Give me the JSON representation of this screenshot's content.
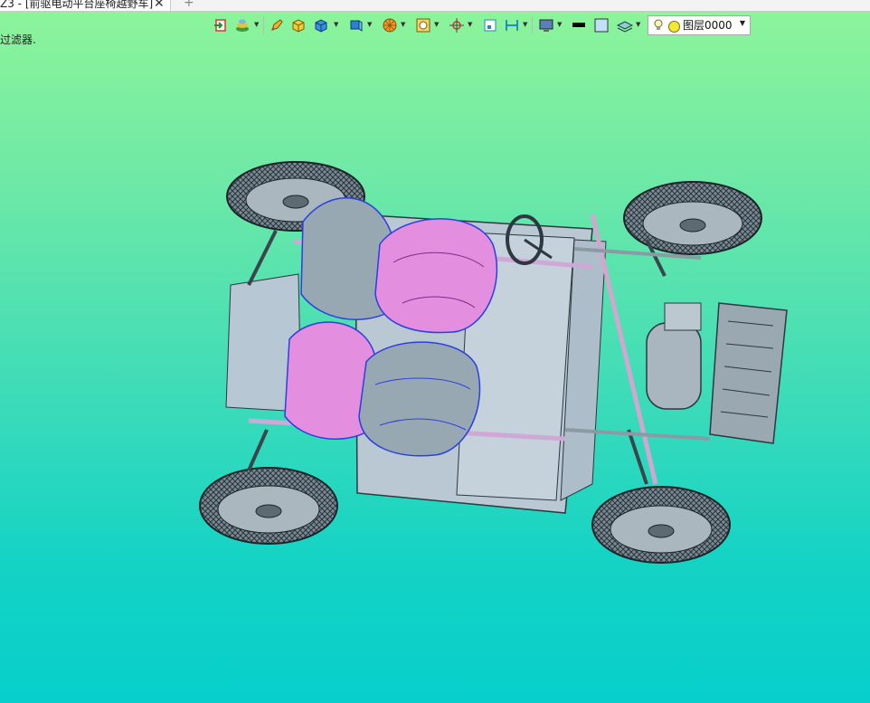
{
  "tab": {
    "title": "Z3 - [前驱电动平台座椅越野车]",
    "close": "✕",
    "new": "+"
  },
  "filter_label": "过滤器.",
  "toolbar": {
    "items": [
      {
        "icon": "exit-sketch-icon"
      },
      {
        "icon": "material-icon"
      },
      {
        "icon": "pencil-icon"
      },
      {
        "icon": "box-yellow-icon"
      },
      {
        "icon": "box-blue-icon"
      },
      {
        "icon": "shaded-box-icon"
      },
      {
        "icon": "wireframe-ball-icon"
      },
      {
        "icon": "zoom-icon"
      },
      {
        "icon": "orient-icon"
      },
      {
        "icon": "frame-icon"
      },
      {
        "icon": "dimension-icon"
      },
      {
        "icon": "display-icon"
      },
      {
        "icon": "color-black-icon"
      },
      {
        "icon": "color-lightblue-icon"
      },
      {
        "icon": "layers-icon"
      }
    ],
    "layer": {
      "name": "图层0000"
    }
  },
  "colors": {
    "accent_seat_pink": "#e48ee0",
    "chassis": "#b8c7d4",
    "wire_blue": "#2c3fe0"
  }
}
